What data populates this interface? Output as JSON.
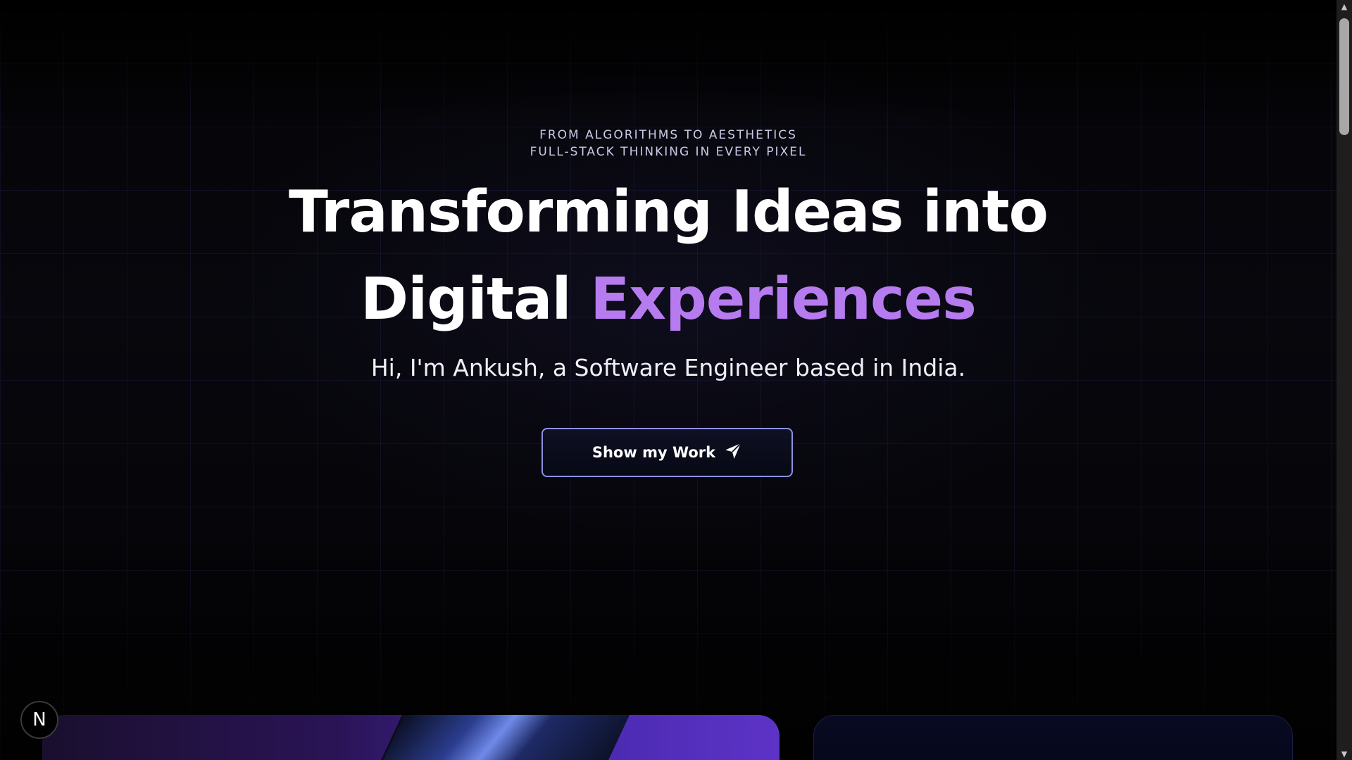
{
  "hero": {
    "eyebrow_line1": "FROM ALGORITHMS TO AESTHETICS",
    "eyebrow_line2": "FULL-STACK THINKING IN EVERY PIXEL",
    "headline_line1": "Transforming Ideas into",
    "headline_line2_plain": "Digital",
    "headline_line2_accent": "Experiences",
    "intro": "Hi, I'm Ankush, a Software Engineer based in India.",
    "cta_label": "Show my Work",
    "cta_icon": "send-arrow-icon"
  },
  "badge": {
    "label": "N"
  },
  "colors": {
    "accent": "#b77bf0",
    "cta_border": "#8f8fe3",
    "background": "#050509"
  },
  "scrollbar": {
    "up": "▲",
    "down": "▼"
  }
}
